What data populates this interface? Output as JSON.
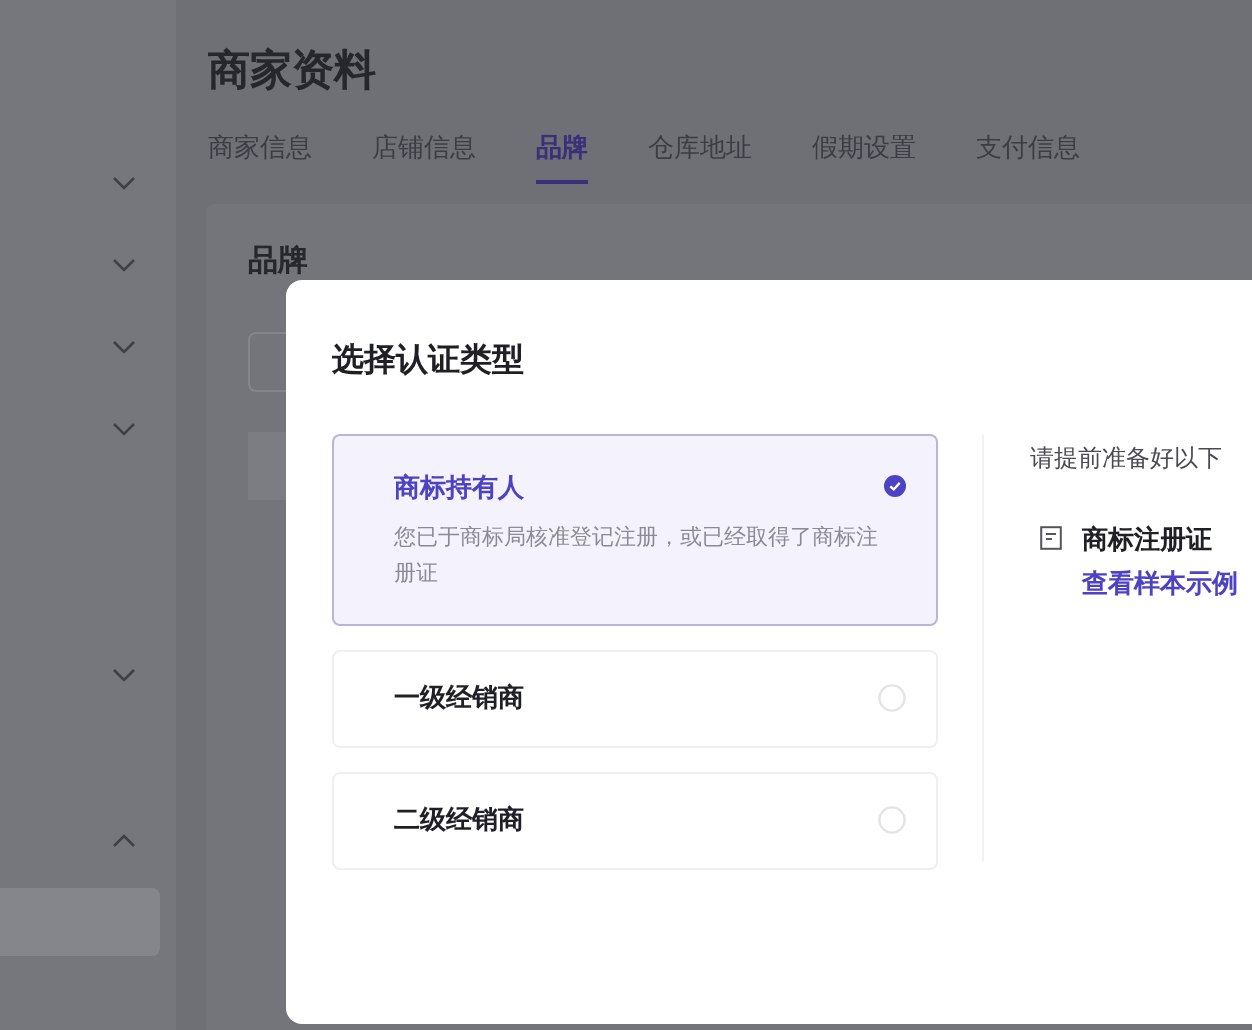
{
  "sidebar": {
    "items": [
      {
        "kind": "group",
        "expanded": false
      },
      {
        "kind": "group",
        "expanded": false
      },
      {
        "kind": "group",
        "expanded": false
      },
      {
        "kind": "group",
        "expanded": false
      },
      {
        "kind": "link"
      },
      {
        "kind": "link"
      },
      {
        "kind": "group",
        "expanded": false
      },
      {
        "kind": "link"
      },
      {
        "kind": "group",
        "expanded": true,
        "children": [
          {
            "selected": true
          }
        ]
      }
    ]
  },
  "page": {
    "title": "商家资料",
    "tabs": [
      {
        "label": "商家信息",
        "selected": false
      },
      {
        "label": "店铺信息",
        "selected": false
      },
      {
        "label": "品牌",
        "selected": true
      },
      {
        "label": "仓库地址",
        "selected": false
      },
      {
        "label": "假期设置",
        "selected": false
      },
      {
        "label": "支付信息",
        "selected": false
      }
    ],
    "card": {
      "title": "品牌"
    }
  },
  "dialog": {
    "title": "选择认证类型",
    "options": [
      {
        "label": "商标持有人",
        "description": "您已于商标局核准登记注册，或已经取得了商标注册证",
        "selected": true
      },
      {
        "label": "一级经销商",
        "selected": false
      },
      {
        "label": "二级经销商",
        "selected": false
      }
    ],
    "hint": "请提前准备好以下",
    "documents": [
      {
        "name": "商标注册证",
        "link": "查看样本示例"
      }
    ]
  }
}
